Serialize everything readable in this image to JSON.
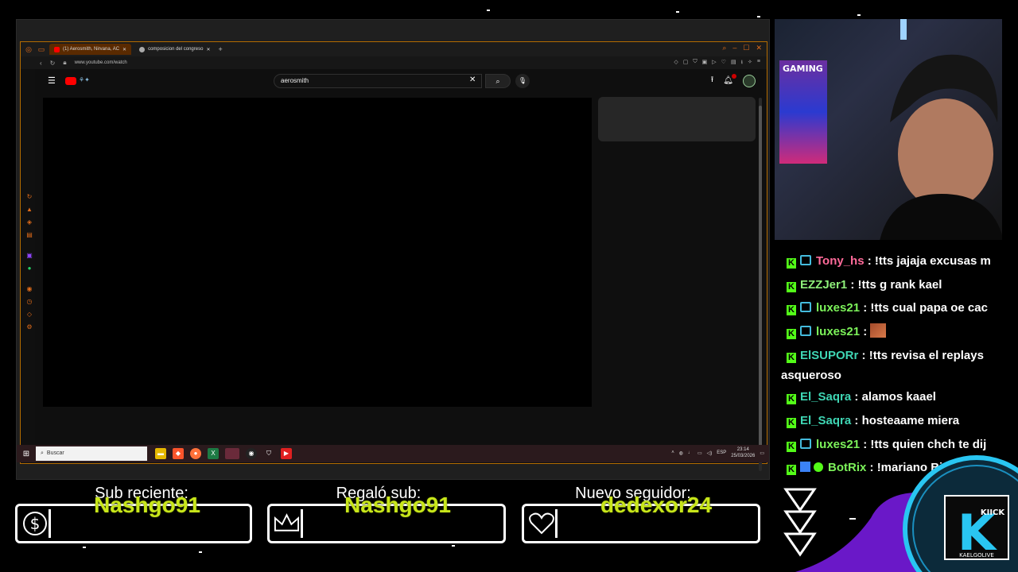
{
  "browser": {
    "tabs": [
      {
        "label": "(1) Aerosmith, Nirvana, AC",
        "active": true
      },
      {
        "label": "composicion del congreso",
        "active": false
      }
    ],
    "url": "www.youtube.com/watch"
  },
  "youtube": {
    "search_value": "aerosmith",
    "notification_count": "9+"
  },
  "taskbar": {
    "search_placeholder": "Buscar",
    "lang": "ESP",
    "time": "23:14",
    "date": "25/03/2026"
  },
  "webcam": {
    "poster_text": "GAMING"
  },
  "chat": {
    "messages": [
      {
        "user": "Tony_hs",
        "color": "#ff6b9a",
        "text": "!tts jajaja excusas m"
      },
      {
        "user": "EZZJer1",
        "color": "#8ef07a",
        "text": "!tts g rank kael"
      },
      {
        "user": "luxes21",
        "color": "#7cf25a",
        "text": "!tts cual papa oe cac"
      },
      {
        "user": "luxes21",
        "color": "#7cf25a",
        "text": ""
      },
      {
        "user": "ElSUPORr",
        "color": "#3fd6b4",
        "text": "!tts revisa el replays asqueroso"
      },
      {
        "user": "El_Saqra",
        "color": "#3fd6b4",
        "text": "alamos kaael"
      },
      {
        "user": "El_Saqra",
        "color": "#3fd6b4",
        "text": "hosteaame miera"
      },
      {
        "user": "luxes21",
        "color": "#7cf25a",
        "text": "!tts quien chch te dij"
      },
      {
        "user": "BotRix",
        "color": "#7cf25a",
        "text": "!mariano Bienvenid"
      }
    ]
  },
  "alerts": {
    "sub_label": "Sub reciente:",
    "sub_name": "Nashgo91",
    "gift_label": "Regaló sub:",
    "gift_name": "Nashgo91",
    "follow_label": "Nuevo seguidor:",
    "follow_name": "dedexor24"
  },
  "brand": {
    "logo_main": "K",
    "logo_tag": "KIICK",
    "logo_sub": "KAELGOLIVE"
  },
  "colors": {
    "accent_orange": "#e06c1a",
    "kick_green": "#53fc18",
    "alert_name": "#c8e61a",
    "logo_ring": "#29c6f2"
  }
}
